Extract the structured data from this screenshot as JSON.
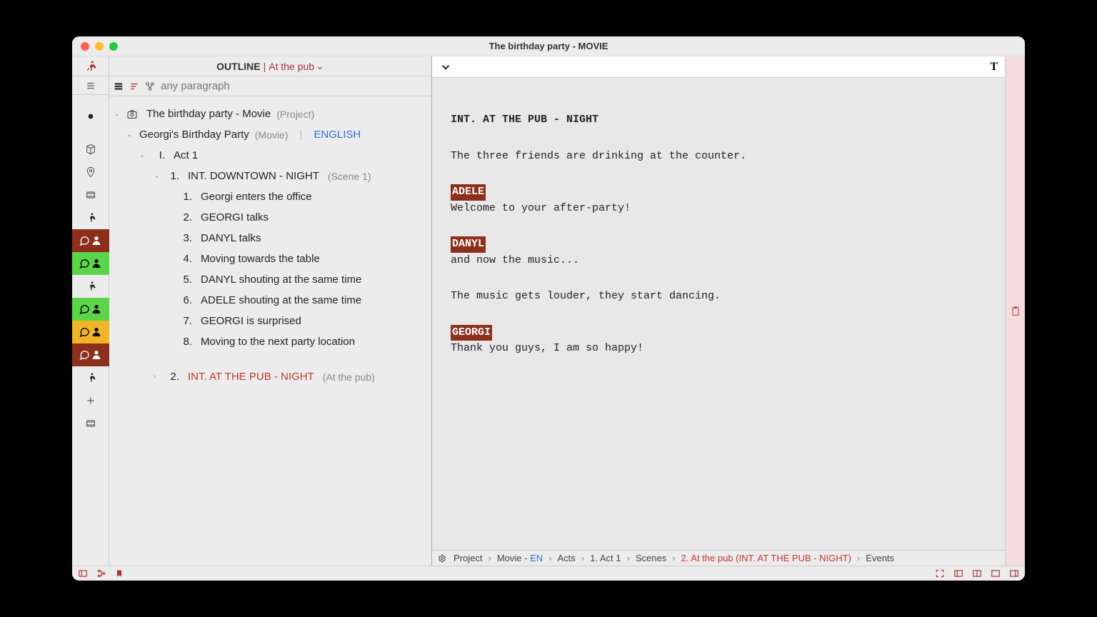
{
  "window": {
    "title": "The birthday party - MOVIE"
  },
  "outline_header": {
    "label": "OUTLINE",
    "crumb": "At the pub"
  },
  "search": {
    "placeholder": "any paragraph"
  },
  "tree": {
    "project": {
      "title": "The birthday party - Movie",
      "tag": "(Project)"
    },
    "movie": {
      "title": "Georgi's Birthday Party",
      "tag": "(Movie)",
      "lang": "ENGLISH"
    },
    "act": {
      "num": "I.",
      "title": "Act 1"
    },
    "scene1": {
      "num": "1.",
      "title": "INT.  DOWNTOWN - NIGHT",
      "tag": "(Scene 1)"
    },
    "beats": [
      {
        "num": "1.",
        "text": "Georgi enters the office"
      },
      {
        "num": "2.",
        "text": "GEORGI talks"
      },
      {
        "num": "3.",
        "text": "DANYL talks"
      },
      {
        "num": "4.",
        "text": "Moving towards the table"
      },
      {
        "num": "5.",
        "text": "DANYL shouting at the same time"
      },
      {
        "num": "6.",
        "text": "ADELE shouting at the same time"
      },
      {
        "num": "7.",
        "text": "GEORGI is surprised"
      },
      {
        "num": "8.",
        "text": "Moving to the next party location"
      }
    ],
    "scene2": {
      "num": "2.",
      "title": "INT.  AT THE PUB - NIGHT",
      "tag": "(At the pub)"
    }
  },
  "script": {
    "slug": "INT. AT THE PUB - NIGHT",
    "action1": "The three friends are drinking at the counter.",
    "c1": "ADELE",
    "d1": "Welcome to your after-party!",
    "c2": "DANYL",
    "d2": "and now the music...",
    "action2": "The music gets louder, they start dancing.",
    "c3": "GEORGI",
    "d3": "Thank you guys, I am so happy!"
  },
  "breadcrumb": {
    "p0": "Project",
    "p1": "Movie -",
    "p1b": "EN",
    "p2": "Acts",
    "p3": "1. Act 1",
    "p4": "Scenes",
    "p5": "2. At the pub (INT.  AT THE PUB - NIGHT)",
    "p6": "Events"
  },
  "editor_top": {
    "text_icon": "T"
  }
}
